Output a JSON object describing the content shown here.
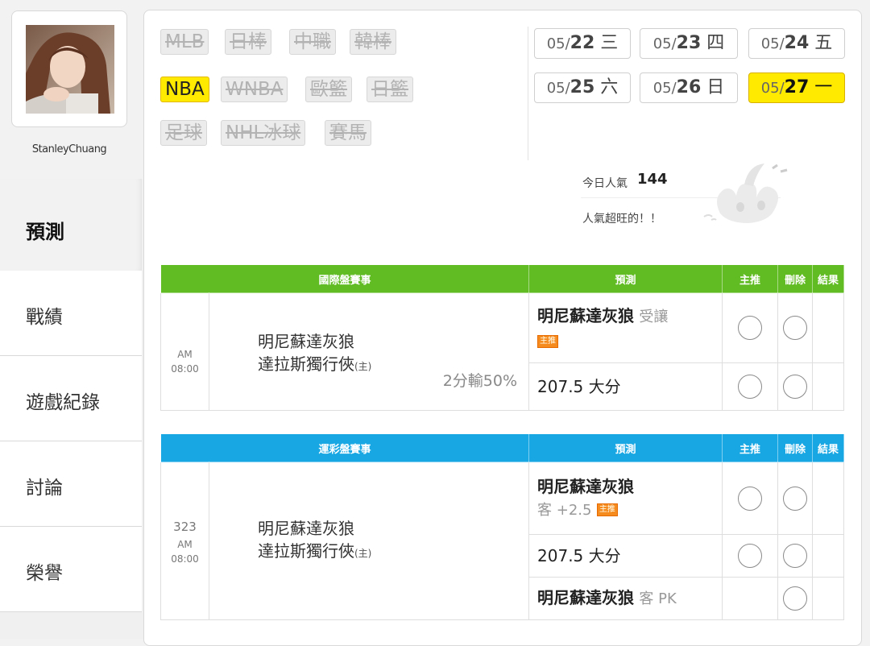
{
  "profile": {
    "username": "StanleyChuang"
  },
  "nav": [
    {
      "label": "預測",
      "active": true
    },
    {
      "label": "戰績"
    },
    {
      "label": "遊戲紀錄"
    },
    {
      "label": "討論"
    },
    {
      "label": "榮譽"
    }
  ],
  "sports": [
    {
      "label": "MLB",
      "active": false
    },
    {
      "label": "日棒",
      "active": false
    },
    {
      "label": "中職",
      "active": false
    },
    {
      "label": "韓棒",
      "active": false
    },
    {
      "label": "NBA",
      "active": true
    },
    {
      "label": "WNBA",
      "active": false
    },
    {
      "label": "歐籃",
      "active": false
    },
    {
      "label": "日籃",
      "active": false
    },
    {
      "label": "足球",
      "active": false
    },
    {
      "label": "NHL冰球",
      "active": false
    },
    {
      "label": "賽馬",
      "active": false
    }
  ],
  "dates": [
    {
      "md": "05/",
      "dd": "22",
      "wk": "三"
    },
    {
      "md": "05/",
      "dd": "23",
      "wk": "四"
    },
    {
      "md": "05/",
      "dd": "24",
      "wk": "五"
    },
    {
      "md": "05/",
      "dd": "25",
      "wk": "六"
    },
    {
      "md": "05/",
      "dd": "26",
      "wk": "日"
    },
    {
      "md": "05/",
      "dd": "27",
      "wk": "一",
      "active": true
    }
  ],
  "popularity": {
    "label": "今日人氣",
    "count": "144",
    "note": "人氣超旺的！！"
  },
  "intl": {
    "headers": [
      "國際盤賽事",
      "預測",
      "主推",
      "刪除",
      "結果"
    ],
    "time_ampm": "AM",
    "time": "08:00",
    "away": "明尼蘇達灰狼",
    "home": "達拉斯獨行俠",
    "home_tag": "(主)",
    "line": "2分輸50%",
    "pred1_team": "明尼蘇達灰狼",
    "pred1_sub": "受讓",
    "badge": "主推",
    "pred2": "207.5 大分"
  },
  "sport": {
    "headers": [
      "運彩盤賽事",
      "預測",
      "主推",
      "刪除",
      "結果"
    ],
    "game_no": "323",
    "time_ampm": "AM",
    "time": "08:00",
    "away": "明尼蘇達灰狼",
    "home": "達拉斯獨行俠",
    "home_tag": "(主)",
    "pred1_team": "明尼蘇達灰狼",
    "pred1_sub": "客 +2.5",
    "badge": "主推",
    "pred2": "207.5 大分",
    "pred3_team": "明尼蘇達灰狼",
    "pred3_sub": "客 PK"
  }
}
